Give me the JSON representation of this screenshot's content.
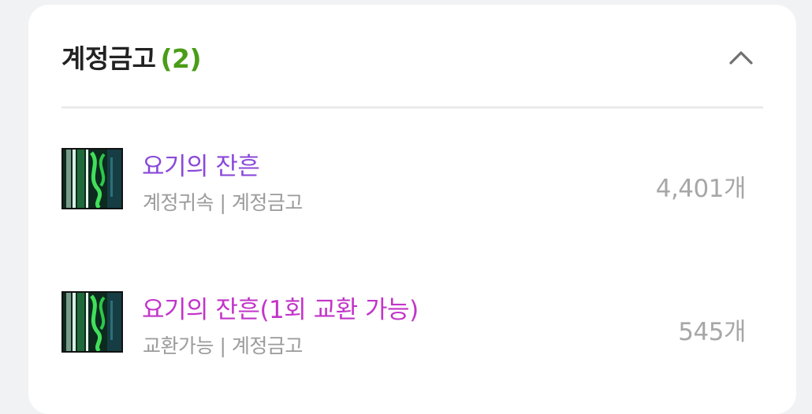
{
  "section": {
    "title": "계정금고",
    "count": "(2)",
    "count_color": "#4a9d17",
    "collapse_icon": "chevron-up-icon"
  },
  "items": [
    {
      "name": "요기의 잔흔",
      "name_color": "#8a49d9",
      "tags": "계정귀속 | 계정금고",
      "quantity": "4,401개",
      "icon": "green-energy-item-icon"
    },
    {
      "name": "요기의 잔흔(1회 교환 가능)",
      "name_color": "#c234c9",
      "tags": "교환가능 | 계정금고",
      "quantity": "545개",
      "icon": "green-energy-item-icon"
    }
  ]
}
